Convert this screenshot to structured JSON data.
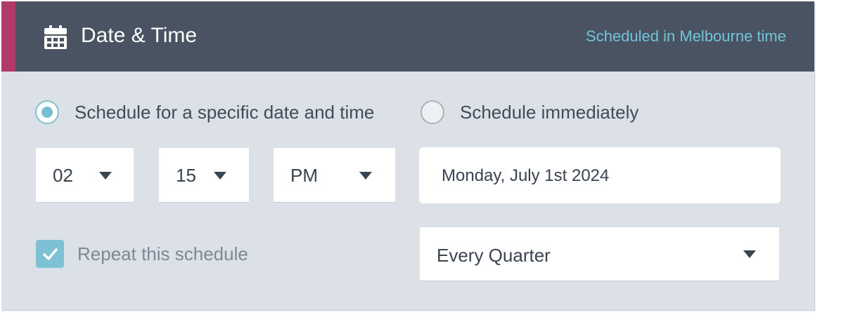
{
  "header": {
    "title": "Date & Time",
    "timezone_note": "Scheduled in Melbourne time",
    "icon": "calendar-icon",
    "accent_color": "#b03a6a",
    "background_color": "#4a5362",
    "note_color": "#72c3d8"
  },
  "schedule_mode": {
    "options": [
      {
        "label": "Schedule for a specific date and time",
        "selected": true
      },
      {
        "label": "Schedule immediately",
        "selected": false
      }
    ]
  },
  "time": {
    "hour": "02",
    "minute": "15",
    "period": "PM"
  },
  "date": {
    "value": "Monday, July 1st 2024"
  },
  "repeat": {
    "label": "Repeat this schedule",
    "checked": true,
    "frequency": "Every Quarter"
  }
}
